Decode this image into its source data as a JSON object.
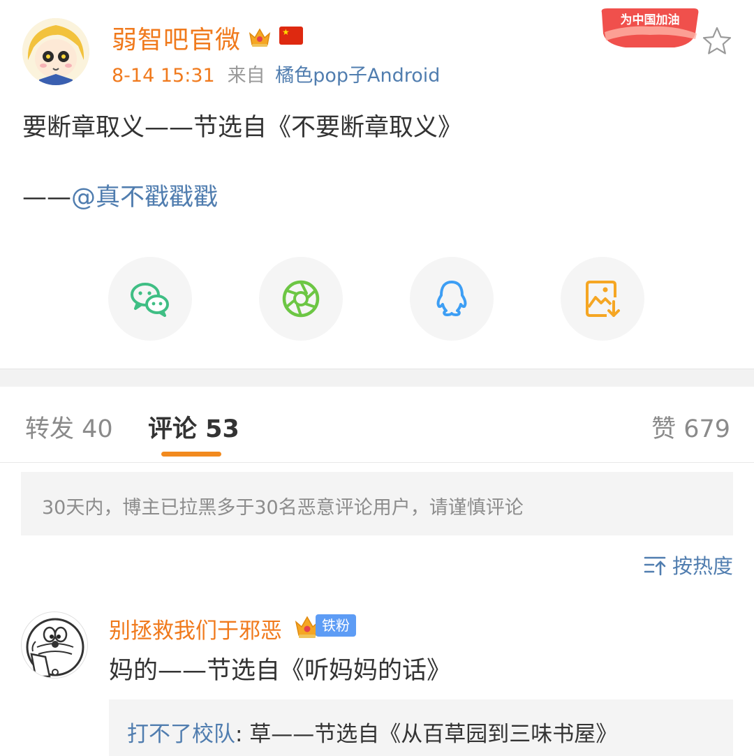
{
  "post": {
    "author": "弱智吧官微",
    "time": "8-14 15:31",
    "from_label": "来自",
    "source": "橘色pop子Android",
    "badge_text": "为中国加油",
    "text": "要断章取义——节选自《不要断章取义》",
    "credit_dash": "——",
    "credit_mention": "@真不戳戳戳"
  },
  "share": {
    "items": [
      {
        "icon": "wechat-icon"
      },
      {
        "icon": "moments-icon"
      },
      {
        "icon": "qq-icon"
      },
      {
        "icon": "save-image-icon"
      }
    ]
  },
  "tabs": {
    "repost": "转发 40",
    "comments": "评论 53",
    "likes": "赞 679"
  },
  "notice": "30天内，博主已拉黑多于30名恶意评论用户，请谨慎评论",
  "sort_label": "按热度",
  "comment": {
    "user": "别拯救我们于邪恶",
    "fan_badge": "铁粉",
    "text": "妈的——节选自《听妈妈的话》",
    "reply_user": "打不了校队",
    "reply_text": ": 草——节选自《从百草园到三味书屋》"
  },
  "colors": {
    "accent_orange": "#f07a1d",
    "link_blue": "#507daf",
    "tab_underline": "#f28a1e"
  }
}
